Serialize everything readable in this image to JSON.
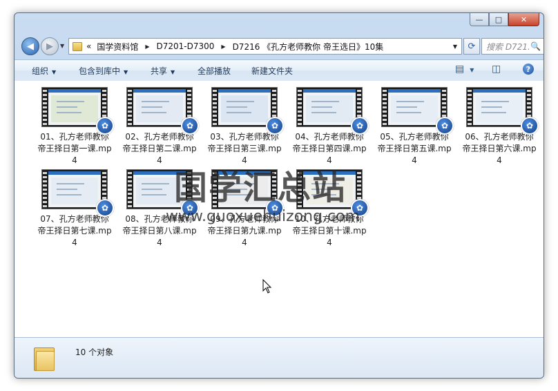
{
  "window": {
    "buttons": {
      "minimize": "—",
      "maximize": "□",
      "close": "✕"
    }
  },
  "address": {
    "overflow": "«",
    "crumbs": [
      "国学资料馆",
      "D7201-D7300",
      "D7216 《孔方老师教你 帝王选日》10集"
    ]
  },
  "search": {
    "placeholder": "搜索 D721..."
  },
  "toolbar": {
    "organize": "组织",
    "include_in_library": "包含到库中",
    "share": "共享",
    "play_all": "全部播放",
    "new_folder": "新建文件夹"
  },
  "files": [
    {
      "name": "01、孔方老师教你帝王择日第一课.mp4"
    },
    {
      "name": "02、孔方老师教你帝王择日第二课.mp4"
    },
    {
      "name": "03、孔方老师教你帝王择日第三课.mp4"
    },
    {
      "name": "04、孔方老师教你帝王择日第四课.mp4"
    },
    {
      "name": "05、孔方老师教你帝王择日第五课.mp4"
    },
    {
      "name": "06、孔方老师教你帝王择日第六课.mp4"
    },
    {
      "name": "07、孔方老师教你帝王择日第七课.mp4"
    },
    {
      "name": "08、孔方老师教你帝王择日第八课.mp4"
    },
    {
      "name": "09、孔方老师教你帝王择日第九课.mp4"
    },
    {
      "name": "10、孔方老师教你帝王择日第十课.mp4"
    }
  ],
  "details": {
    "count_text": "10 个对象"
  },
  "watermark": {
    "title": "国学汇总站",
    "url": "www.guoxuehuizong.com"
  },
  "icons": [
    "back-arrow-icon",
    "forward-arrow-icon",
    "folder-icon",
    "refresh-icon",
    "search-icon",
    "view-icon",
    "preview-pane-icon",
    "help-icon",
    "video-file-icon"
  ]
}
